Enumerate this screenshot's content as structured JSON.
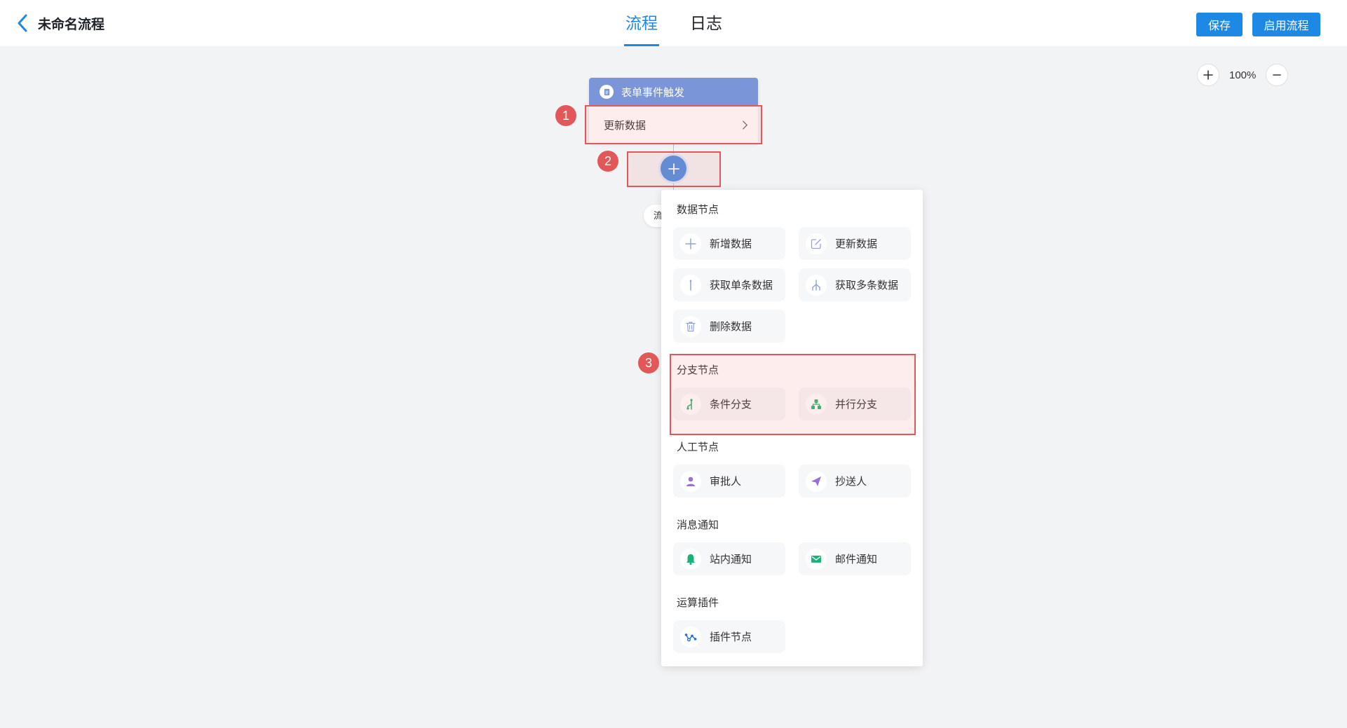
{
  "header": {
    "title": "未命名流程",
    "tabs": [
      {
        "label": "流程",
        "active": true
      },
      {
        "label": "日志",
        "active": false
      }
    ],
    "save_label": "保存",
    "enable_label": "启用流程"
  },
  "zoom": {
    "level": "100%"
  },
  "flow": {
    "trigger_title": "表单事件触发",
    "trigger_action": "更新数据",
    "end_label": "流"
  },
  "annotations": [
    "1",
    "2",
    "3"
  ],
  "panel": {
    "sections": [
      {
        "title": "数据节点",
        "items": [
          {
            "label": "新增数据",
            "icon": "plus-icon"
          },
          {
            "label": "更新数据",
            "icon": "edit-icon"
          },
          {
            "label": "获取单条数据",
            "icon": "single-line-icon"
          },
          {
            "label": "获取多条数据",
            "icon": "multi-branch-icon"
          },
          {
            "label": "删除数据",
            "icon": "trash-icon"
          }
        ]
      },
      {
        "title": "分支节点",
        "items": [
          {
            "label": "条件分支",
            "icon": "condition-branch-icon"
          },
          {
            "label": "并行分支",
            "icon": "parallel-branch-icon"
          }
        ]
      },
      {
        "title": "人工节点",
        "items": [
          {
            "label": "审批人",
            "icon": "user-icon"
          },
          {
            "label": "抄送人",
            "icon": "send-icon"
          }
        ]
      },
      {
        "title": "消息通知",
        "items": [
          {
            "label": "站内通知",
            "icon": "bell-icon"
          },
          {
            "label": "邮件通知",
            "icon": "mail-icon"
          }
        ]
      },
      {
        "title": "运算插件",
        "items": [
          {
            "label": "插件节点",
            "icon": "plugin-icon"
          }
        ]
      }
    ]
  },
  "colors": {
    "accent": "#1e88e5",
    "trigger_header": "#7b96d8",
    "highlight": "#e25858",
    "data_icon": "#8fa3d9",
    "branch_icon": "#2bb673",
    "person_icon": "#9b6fd8",
    "notify_icon": "#19b37a"
  }
}
